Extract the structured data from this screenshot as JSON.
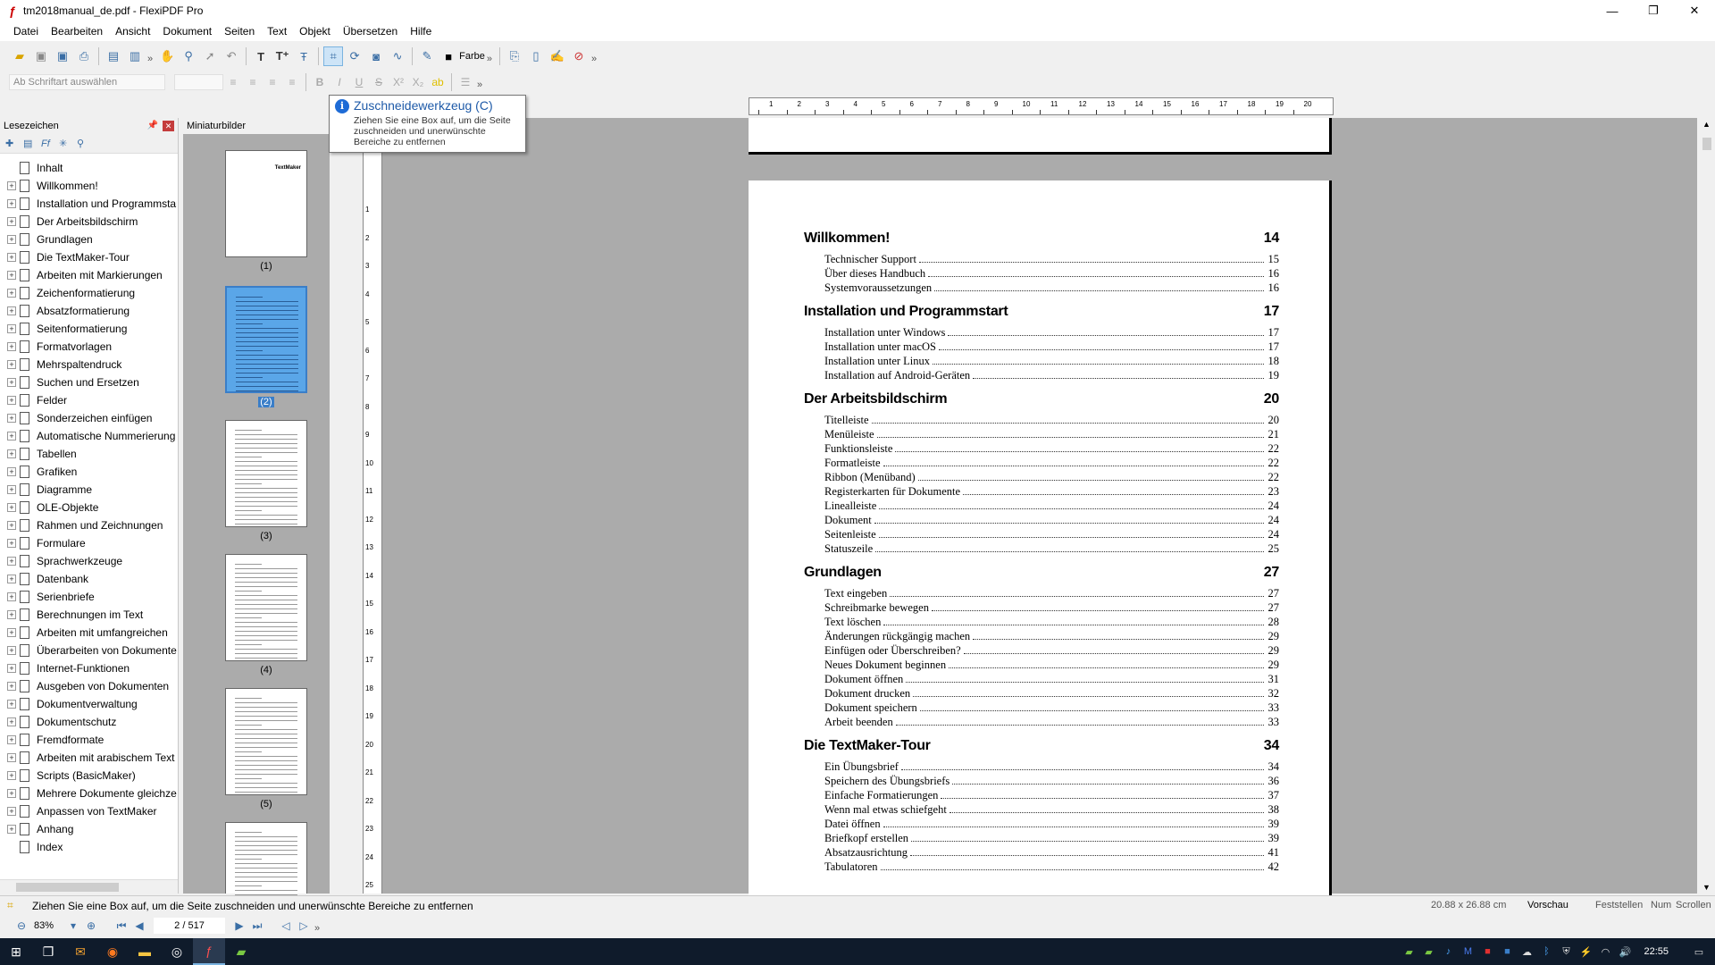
{
  "window": {
    "title": "tm2018manual_de.pdf - FlexiPDF Pro",
    "minimize": "—",
    "maximize": "❐",
    "close": "✕"
  },
  "menu": [
    "Datei",
    "Bearbeiten",
    "Ansicht",
    "Dokument",
    "Seiten",
    "Text",
    "Objekt",
    "Übersetzen",
    "Hilfe"
  ],
  "toolbar": {
    "color_label": "Farbe",
    "font_placeholder": "Ab Schriftart auswählen"
  },
  "tooltip": {
    "title": "Zuschneidewerkzeug (C)",
    "description": "Ziehen Sie eine Box auf, um die Seite zuschneiden und unerwünschte Bereiche zu entfernen"
  },
  "bookmarks": {
    "title": "Lesezeichen",
    "items": [
      {
        "label": "Inhalt",
        "exp": false
      },
      {
        "label": "Willkommen!",
        "exp": true
      },
      {
        "label": "Installation und Programmstart",
        "exp": true
      },
      {
        "label": "Der Arbeitsbildschirm",
        "exp": true
      },
      {
        "label": "Grundlagen",
        "exp": true
      },
      {
        "label": "Die TextMaker-Tour",
        "exp": true
      },
      {
        "label": "Arbeiten mit Markierungen",
        "exp": true
      },
      {
        "label": "Zeichenformatierung",
        "exp": true
      },
      {
        "label": "Absatzformatierung",
        "exp": true
      },
      {
        "label": "Seitenformatierung",
        "exp": true
      },
      {
        "label": "Formatvorlagen",
        "exp": true
      },
      {
        "label": "Mehrspaltendruck",
        "exp": true
      },
      {
        "label": "Suchen und Ersetzen",
        "exp": true
      },
      {
        "label": "Felder",
        "exp": true
      },
      {
        "label": "Sonderzeichen einfügen",
        "exp": true
      },
      {
        "label": "Automatische Nummerierung",
        "exp": true
      },
      {
        "label": "Tabellen",
        "exp": true
      },
      {
        "label": "Grafiken",
        "exp": true
      },
      {
        "label": "Diagramme",
        "exp": true
      },
      {
        "label": "OLE-Objekte",
        "exp": true
      },
      {
        "label": "Rahmen und Zeichnungen",
        "exp": true
      },
      {
        "label": "Formulare",
        "exp": true
      },
      {
        "label": "Sprachwerkzeuge",
        "exp": true
      },
      {
        "label": "Datenbank",
        "exp": true
      },
      {
        "label": "Serienbriefe",
        "exp": true
      },
      {
        "label": "Berechnungen im Text",
        "exp": true
      },
      {
        "label": "Arbeiten mit umfangreichen",
        "exp": true
      },
      {
        "label": "Überarbeiten von Dokumente",
        "exp": true
      },
      {
        "label": "Internet-Funktionen",
        "exp": true
      },
      {
        "label": "Ausgeben von Dokumenten",
        "exp": true
      },
      {
        "label": "Dokumentverwaltung",
        "exp": true
      },
      {
        "label": "Dokumentschutz",
        "exp": true
      },
      {
        "label": "Fremdformate",
        "exp": true
      },
      {
        "label": "Arbeiten mit arabischem Text",
        "exp": true
      },
      {
        "label": "Scripts (BasicMaker)",
        "exp": true
      },
      {
        "label": "Mehrere Dokumente gleichze",
        "exp": true
      },
      {
        "label": "Anpassen von TextMaker",
        "exp": true
      },
      {
        "label": "Anhang",
        "exp": true
      },
      {
        "label": "Index",
        "exp": false
      }
    ]
  },
  "thumbnails": {
    "title": "Miniaturbilder",
    "labels": [
      "(1)",
      "(2)",
      "(3)",
      "(4)",
      "(5)"
    ],
    "page1_title": "TextMaker"
  },
  "toc": [
    {
      "title": "Willkommen!",
      "page": "14",
      "entries": [
        [
          "Technischer Support",
          "15"
        ],
        [
          "Über dieses Handbuch",
          "16"
        ],
        [
          "Systemvoraussetzungen",
          "16"
        ]
      ]
    },
    {
      "title": "Installation und Programmstart",
      "page": "17",
      "entries": [
        [
          "Installation unter Windows",
          "17"
        ],
        [
          "Installation unter macOS",
          "17"
        ],
        [
          "Installation unter Linux",
          "18"
        ],
        [
          "Installation auf Android-Geräten",
          "19"
        ]
      ]
    },
    {
      "title": "Der Arbeitsbildschirm",
      "page": "20",
      "entries": [
        [
          "Titelleiste",
          "20"
        ],
        [
          "Menüleiste",
          "21"
        ],
        [
          "Funktionsleiste",
          "22"
        ],
        [
          "Formatleiste",
          "22"
        ],
        [
          "Ribbon (Menüband)",
          "22"
        ],
        [
          "Registerkarten für Dokumente",
          "23"
        ],
        [
          "Linealleiste",
          "24"
        ],
        [
          "Dokument",
          "24"
        ],
        [
          "Seitenleiste",
          "24"
        ],
        [
          "Statuszeile",
          "25"
        ]
      ]
    },
    {
      "title": "Grundlagen",
      "page": "27",
      "entries": [
        [
          "Text eingeben",
          "27"
        ],
        [
          "Schreibmarke bewegen",
          "27"
        ],
        [
          "Text löschen",
          "28"
        ],
        [
          "Änderungen rückgängig machen",
          "29"
        ],
        [
          "Einfügen oder Überschreiben?",
          "29"
        ],
        [
          "Neues Dokument beginnen",
          "29"
        ],
        [
          "Dokument öffnen",
          "31"
        ],
        [
          "Dokument drucken",
          "32"
        ],
        [
          "Dokument speichern",
          "33"
        ],
        [
          "Arbeit beenden",
          "33"
        ]
      ]
    },
    {
      "title": "Die TextMaker-Tour",
      "page": "34",
      "entries": [
        [
          "Ein Übungsbrief",
          "34"
        ],
        [
          "Speichern des Übungsbriefs",
          "36"
        ],
        [
          "Einfache Formatierungen",
          "37"
        ],
        [
          "Wenn mal etwas schiefgeht",
          "38"
        ],
        [
          "Datei öffnen",
          "39"
        ],
        [
          "Briefkopf erstellen",
          "39"
        ],
        [
          "Absatzausrichtung",
          "41"
        ],
        [
          "Tabulatoren",
          "42"
        ]
      ]
    }
  ],
  "ruler_h": [
    "1",
    "2",
    "3",
    "4",
    "5",
    "6",
    "7",
    "8",
    "9",
    "10",
    "11",
    "12",
    "13",
    "14",
    "15",
    "16",
    "17",
    "18",
    "19",
    "20"
  ],
  "ruler_v": [
    "1",
    "2",
    "3",
    "4",
    "5",
    "6",
    "7",
    "8",
    "9",
    "10",
    "11",
    "12",
    "13",
    "14",
    "15",
    "16",
    "17",
    "18",
    "19",
    "20",
    "21",
    "22",
    "23",
    "24",
    "25"
  ],
  "status": {
    "message": "Ziehen Sie eine Box auf, um die Seite zuschneiden und unerwünschte Bereiche zu entfernen",
    "dimensions": "20.88 x 26.88 cm",
    "mode": "Vorschau",
    "fix": "Feststellen",
    "num": "Num",
    "scroll": "Scrollen"
  },
  "nav": {
    "zoom": "83%",
    "page": "2 / 517"
  },
  "taskbar": {
    "time": "22:55"
  }
}
